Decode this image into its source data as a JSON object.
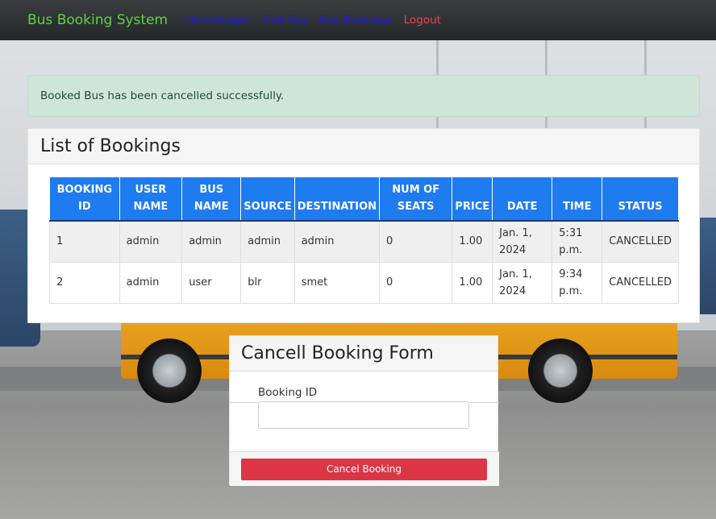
{
  "navbar": {
    "brand": "Bus Booking System",
    "links": [
      {
        "label": "Home/Login"
      },
      {
        "label": "Find Bus"
      },
      {
        "label": "See Bookings"
      },
      {
        "label": "Logout"
      }
    ]
  },
  "alert": {
    "message": "Booked Bus has been cancelled successfully."
  },
  "bookings": {
    "title": "List of Bookings",
    "columns": [
      "BOOKING ID",
      "USER NAME",
      "BUS NAME",
      "SOURCE",
      "DESTINATION",
      "NUM OF SEATS",
      "PRICE",
      "DATE",
      "TIME",
      "STATUS"
    ],
    "rows": [
      [
        "1",
        "admin",
        "admin",
        "admin",
        "admin",
        "0",
        "1.00",
        "Jan. 1, 2024",
        "5:31 p.m.",
        "CANCELLED"
      ],
      [
        "2",
        "admin",
        "user",
        "blr",
        "smet",
        "0",
        "1.00",
        "Jan. 1, 2024",
        "9:34 p.m.",
        "CANCELLED"
      ]
    ]
  },
  "cancel_form": {
    "title": "Cancell Booking Form",
    "booking_id_label": "Booking ID",
    "booking_id_value": "",
    "submit_label": "Cancel Booking"
  },
  "colors": {
    "brand": "#5cd33a",
    "nav_link": "#1a1ad6",
    "logout": "#e8454e",
    "table_header": "#1e7bf0",
    "alert_bg": "#cfe5d9",
    "danger": "#dc3545"
  }
}
